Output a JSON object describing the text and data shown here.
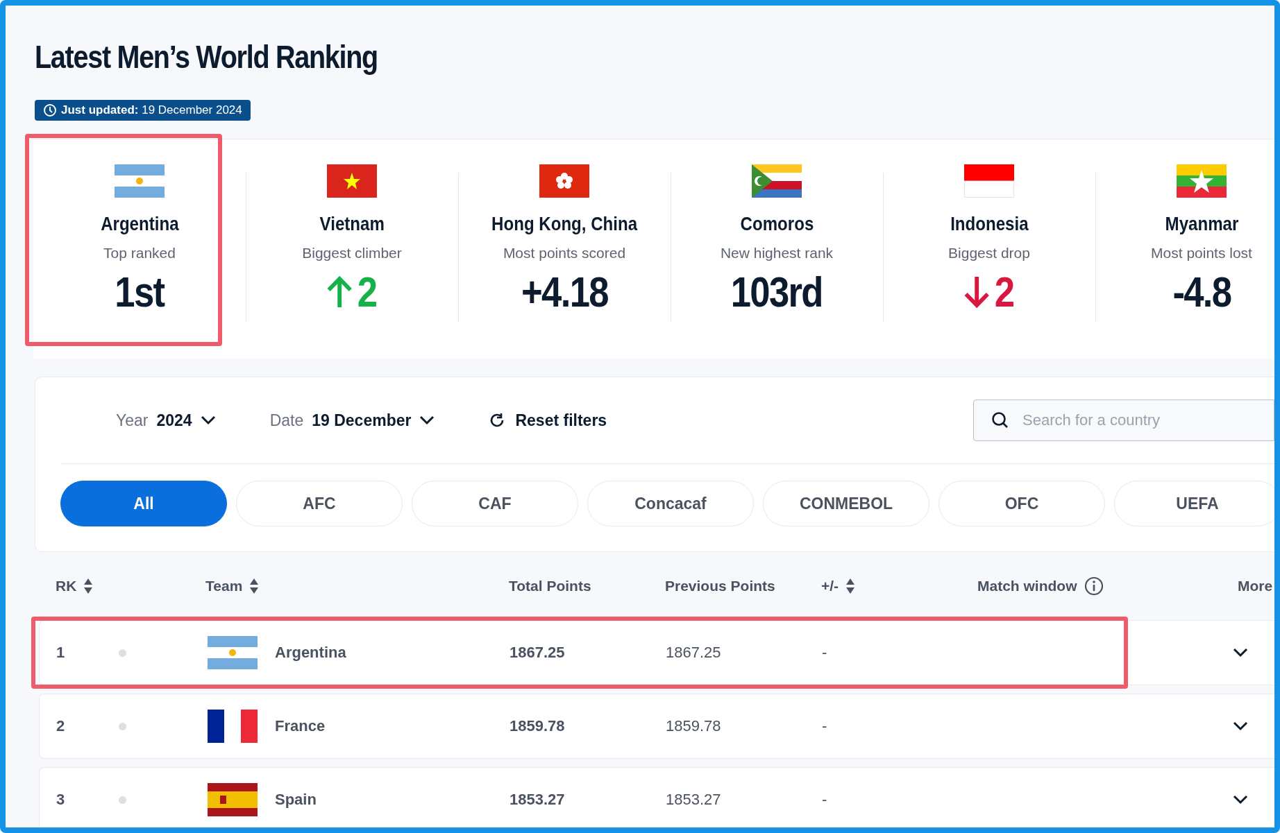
{
  "title": "Latest Men’s World Ranking",
  "update_badge": {
    "label": "Just updated:",
    "date": "19 December 2024"
  },
  "highlights": [
    {
      "country": "Argentina",
      "caption": "Top ranked",
      "value": "1st",
      "kind": "plain",
      "highlighted": true
    },
    {
      "country": "Vietnam",
      "caption": "Biggest climber",
      "value": "2",
      "kind": "up",
      "highlighted": false
    },
    {
      "country": "Hong Kong, China",
      "caption": "Most points scored",
      "value": "+4.18",
      "kind": "plain",
      "highlighted": false
    },
    {
      "country": "Comoros",
      "caption": "New highest rank",
      "value": "103rd",
      "kind": "plain",
      "highlighted": false
    },
    {
      "country": "Indonesia",
      "caption": "Biggest drop",
      "value": "2",
      "kind": "down",
      "highlighted": false
    },
    {
      "country": "Myanmar",
      "caption": "Most points lost",
      "value": "-4.8",
      "kind": "plain",
      "highlighted": false
    }
  ],
  "filters": {
    "year": {
      "label": "Year",
      "value": "2024"
    },
    "date": {
      "label": "Date",
      "value": "19 December"
    },
    "reset": "Reset filters",
    "search": {
      "placeholder": "Search for a country"
    }
  },
  "confederations": [
    {
      "label": "All",
      "selected": true
    },
    {
      "label": "AFC",
      "selected": false
    },
    {
      "label": "CAF",
      "selected": false
    },
    {
      "label": "Concacaf",
      "selected": false
    },
    {
      "label": "CONMEBOL",
      "selected": false
    },
    {
      "label": "OFC",
      "selected": false
    },
    {
      "label": "UEFA",
      "selected": false
    }
  ],
  "table": {
    "columns": [
      {
        "label": "RK",
        "sortable": true
      },
      {
        "label": "Team",
        "sortable": true
      },
      {
        "label": "Total Points",
        "sortable": false
      },
      {
        "label": "Previous Points",
        "sortable": false
      },
      {
        "label": "+/-",
        "sortable": true
      },
      {
        "label": "Match window",
        "sortable": false
      },
      {
        "label": "More",
        "sortable": false
      }
    ],
    "rows": [
      {
        "rank": "1",
        "team": "Argentina",
        "total": "1867.25",
        "previous": "1867.25",
        "change": "-",
        "highlighted": true
      },
      {
        "rank": "2",
        "team": "France",
        "total": "1859.78",
        "previous": "1859.78",
        "change": "-",
        "highlighted": false
      },
      {
        "rank": "3",
        "team": "Spain",
        "total": "1853.27",
        "previous": "1853.27",
        "change": "-",
        "highlighted": false
      }
    ]
  }
}
